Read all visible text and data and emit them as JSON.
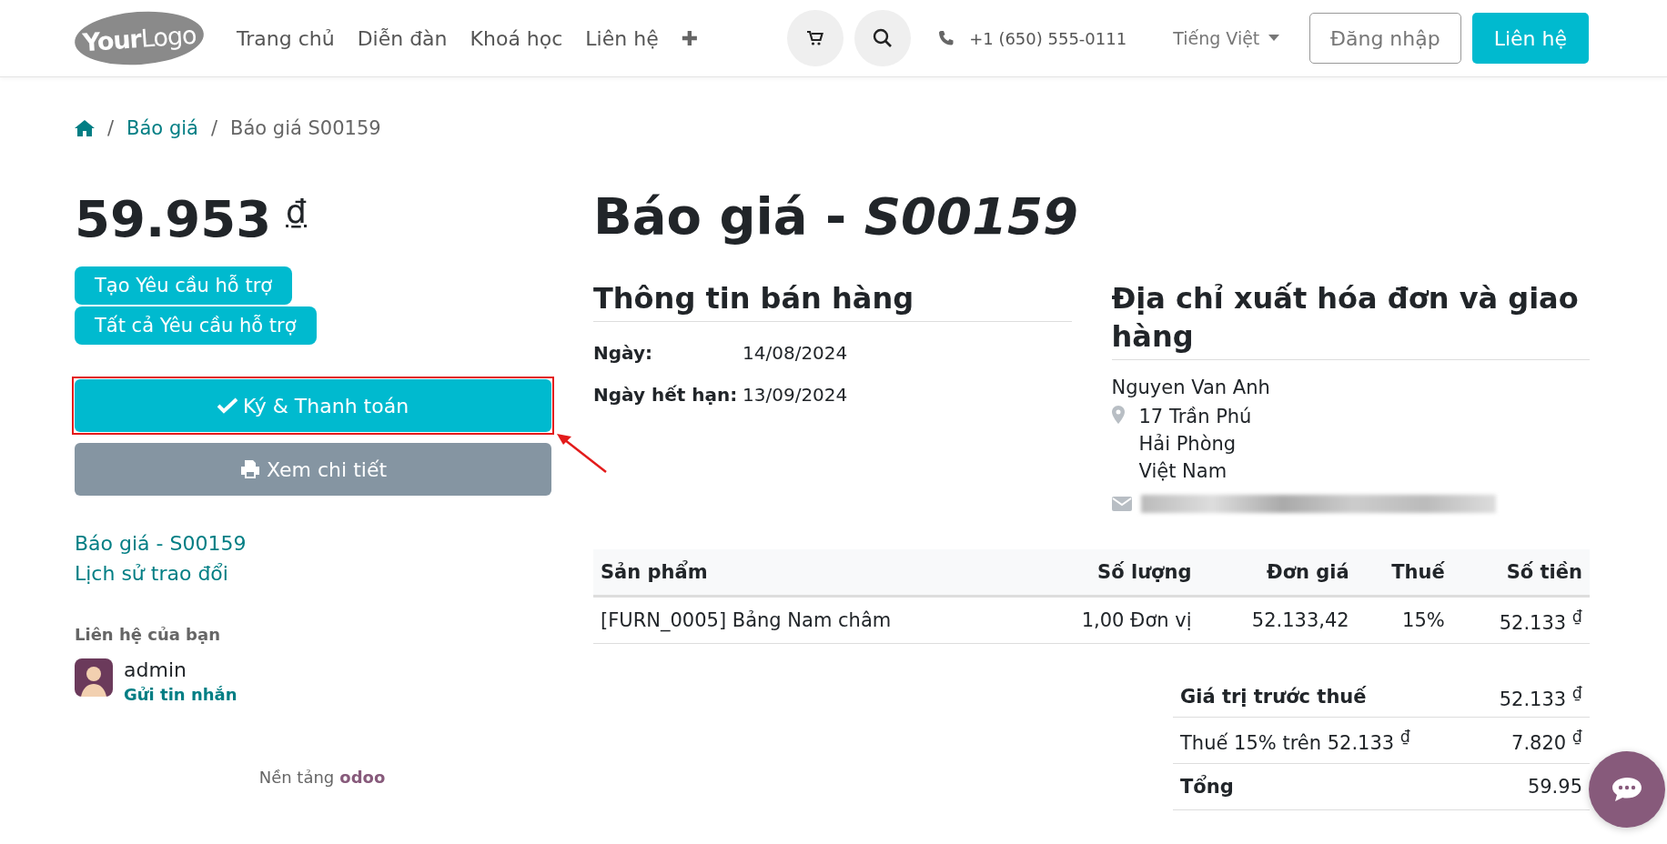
{
  "header": {
    "logo": "**Your**Logo",
    "nav": [
      {
        "label": "Trang chủ"
      },
      {
        "label": "Diễn đàn"
      },
      {
        "label": "Khoá học"
      },
      {
        "label": "Liên hệ"
      }
    ],
    "nav_more": "✚",
    "phone": "+1 (650) 555-0111",
    "language": "Tiếng Việt",
    "login": "Đăng nhập",
    "contact": "Liên hệ"
  },
  "breadcrumb": {
    "separator": "/",
    "link": "Báo giá",
    "current": "Báo giá S00159"
  },
  "sidebar": {
    "amount": "59.953",
    "currency": "₫",
    "ticket_buttons": [
      "Tạo Yêu cầu hỗ trợ",
      "Tất cả Yêu cầu hỗ trợ"
    ],
    "sign_button": "Ký & Thanh toán",
    "view_button": "Xem chi tiết",
    "links": [
      "Báo giá - S00159",
      "Lịch sử trao đổi"
    ],
    "contact_heading": "Liên hệ của bạn",
    "contact_name": "admin",
    "message_link": "Gửi tin nhắn",
    "powered_by": "Nền tảng",
    "brand": "odoo"
  },
  "document": {
    "title": "Báo giá - *S00159*",
    "sales_heading": "Thông tin bán hàng",
    "fields": [
      {
        "label": "Ngày:",
        "value": "14/08/2024"
      },
      {
        "label": "Ngày hết hạn:",
        "value": "13/09/2024"
      }
    ],
    "address_heading": "Địa chỉ xuất hóa đơn và giao hàng",
    "customer": "Nguyen Van Anh",
    "address_lines": [
      "17 Trần Phú",
      "Hải Phòng",
      "Việt Nam"
    ],
    "table": {
      "columns": [
        "Sản phẩm",
        "Số lượng",
        "Đơn giá",
        "Thuế",
        "Số tiền"
      ],
      "rows": [
        [
          "[FURN_0005] Bảng Nam châm",
          "1,00 Đơn vị",
          "52.133,42",
          "15%",
          "52.133 $^{₫}$"
        ]
      ]
    },
    "totals": [
      {
        "label": "Giá trị trước thuế",
        "value": "52.133 $^{₫}$",
        "bold": true
      },
      {
        "label": "Thuế 15% trên 52.133 $^{₫}$",
        "value": "7.820 $^{₫}$",
        "bold": false
      },
      {
        "label": "Tổng",
        "value": "59.95",
        "bold": true
      }
    ]
  }
}
